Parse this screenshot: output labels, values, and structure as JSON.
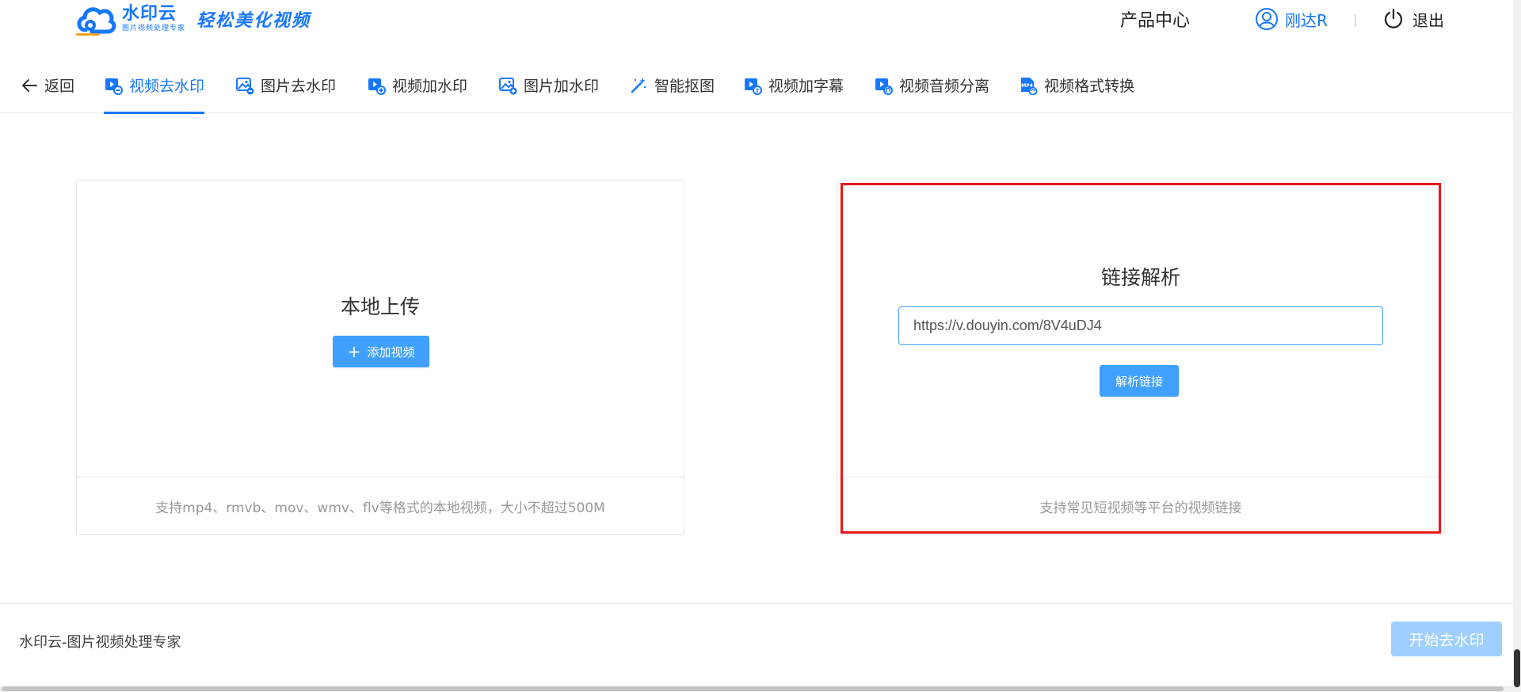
{
  "header": {
    "logo_name": "水印云",
    "logo_sub": "图片视频处理专家",
    "slogan": "轻松美化视频",
    "product_center": "产品中心",
    "username": "刚达R",
    "separator": "|",
    "logout": "退出"
  },
  "nav": {
    "back": "返回",
    "items": [
      {
        "label": "视频去水印",
        "icon": "video-remove-watermark-icon",
        "active": true
      },
      {
        "label": "图片去水印",
        "icon": "image-remove-watermark-icon"
      },
      {
        "label": "视频加水印",
        "icon": "video-add-watermark-icon"
      },
      {
        "label": "图片加水印",
        "icon": "image-add-watermark-icon"
      },
      {
        "label": "智能抠图",
        "icon": "magic-wand-icon"
      },
      {
        "label": "视频加字幕",
        "icon": "video-subtitle-icon"
      },
      {
        "label": "视频音频分离",
        "icon": "audio-separate-icon"
      },
      {
        "label": "视频格式转换",
        "icon": "mp4-file-icon"
      }
    ]
  },
  "local_upload": {
    "title": "本地上传",
    "button_icon": "+",
    "button": "添加视频",
    "hint": "支持mp4、rmvb、mov、wmv、flv等格式的本地视频，大小不超过500M"
  },
  "link_parse": {
    "title": "链接解析",
    "input_value": "https://v.douyin.com/8V4uDJ4",
    "button": "解析链接",
    "hint": "支持常见短视频等平台的视频链接"
  },
  "footer": {
    "brand_text": "水印云-图片视频处理专家",
    "start_button": "开始去水印"
  },
  "colors": {
    "primary": "#1677ff",
    "button": "#40a0ff",
    "button_disabled": "#a0cfff",
    "highlight": "#e81818"
  }
}
